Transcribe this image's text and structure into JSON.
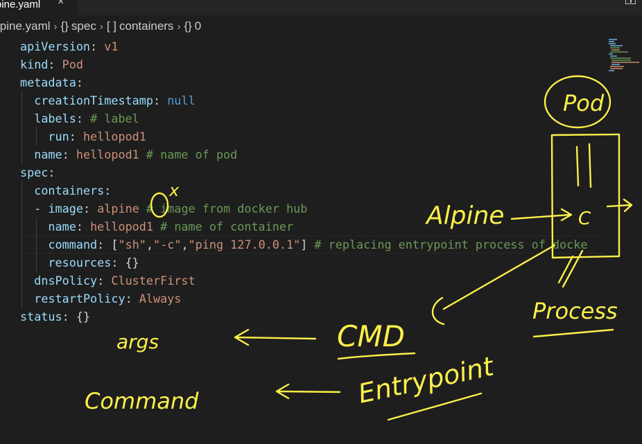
{
  "tab": {
    "label": "pine.yaml",
    "close_glyph": "×"
  },
  "breadcrumb": [
    {
      "icon": "",
      "label": "lpine.yaml"
    },
    {
      "icon": "{}",
      "label": "spec"
    },
    {
      "icon": "[ ]",
      "label": "containers"
    },
    {
      "icon": "{}",
      "label": "0"
    }
  ],
  "breadcrumb_separator": "›",
  "code": {
    "l1_key": "apiVersion",
    "l1_val": "v1",
    "l2_key": "kind",
    "l2_val": "Pod",
    "l3_key": "metadata",
    "l4_key": "creationTimestamp",
    "l4_val": "null",
    "l5_key": "labels",
    "l5_comment": "# label",
    "l6_key": "run",
    "l6_val": "hellopod1",
    "l7_key": "name",
    "l7_val": "hellopod1",
    "l7_comment": "# name of pod",
    "l8_key": "spec",
    "l9_key": "containers",
    "l10_dash": "-",
    "l10_key": "image",
    "l10_val": "alpine",
    "l10_comment": "# image from docker hub",
    "l11_key": "name",
    "l11_val": "hellopod1",
    "l11_comment": "# name of container",
    "l12_key": "command",
    "l12_open": "[",
    "l12_v1": "\"sh\"",
    "l12_v2": "\"-c\"",
    "l12_v3": "\"ping 127.0.0.1\"",
    "l12_close": "]",
    "l12_comment": "# replacing entrypoint process of docke",
    "l13_key": "resources",
    "l13_val": "{}",
    "l14_key": "dnsPolicy",
    "l14_val": "ClusterFirst",
    "l15_key": "restartPolicy",
    "l15_val": "Always",
    "l16_key": "status",
    "l16_val": "{}"
  },
  "annotations": {
    "pod": "Pod",
    "alpine": "Alpine",
    "container_c": "C",
    "x_mark": "x",
    "process": "Process",
    "cmd": "CMD",
    "args": "args",
    "entrypoint": "Entrypoint",
    "command": "Command"
  },
  "colors": {
    "background": "#1e1e1e",
    "key": "#9cdcfe",
    "string": "#ce9178",
    "keyword": "#569cd6",
    "comment": "#6a9955",
    "ink": "#fdf04a"
  }
}
